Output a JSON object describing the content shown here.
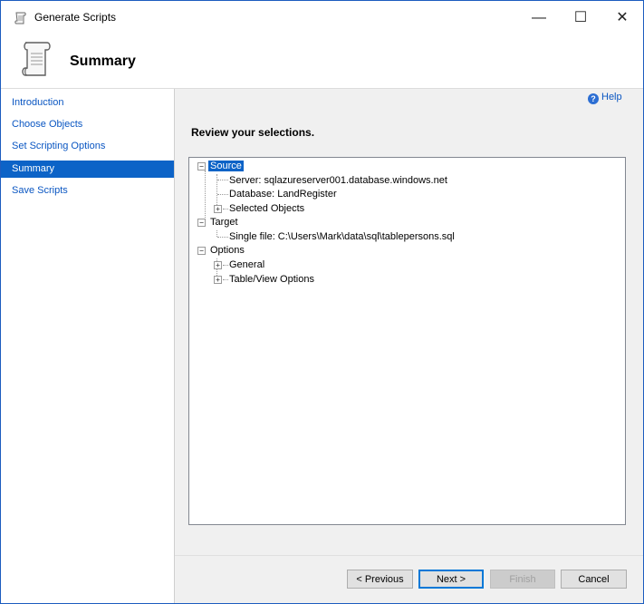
{
  "window": {
    "title": "Generate Scripts",
    "minimize": "—",
    "maximize": "☐",
    "close": "✕"
  },
  "header": {
    "title": "Summary",
    "icon": "scroll-icon"
  },
  "sidebar": {
    "items": [
      {
        "label": "Introduction",
        "active": false
      },
      {
        "label": "Choose Objects",
        "active": false
      },
      {
        "label": "Set Scripting Options",
        "active": false
      },
      {
        "label": "Summary",
        "active": true
      },
      {
        "label": "Save Scripts",
        "active": false
      }
    ]
  },
  "help": {
    "label": "Help",
    "icon": "help-icon"
  },
  "main": {
    "heading": "Review your selections.",
    "tree": {
      "source": "Source",
      "server": "Server: sqlazureserver001.database.windows.net",
      "database": "Database: LandRegister",
      "selected_objects": "Selected Objects",
      "target": "Target",
      "single_file": "Single file: C:\\Users\\Mark\\data\\sql\\tablepersons.sql",
      "options": "Options",
      "general": "General",
      "table_view": "Table/View Options"
    }
  },
  "buttons": {
    "previous": "< Previous",
    "next": "Next >",
    "finish": "Finish",
    "cancel": "Cancel"
  },
  "colors": {
    "accent": "#0c63c7",
    "link": "#0a56c2"
  }
}
